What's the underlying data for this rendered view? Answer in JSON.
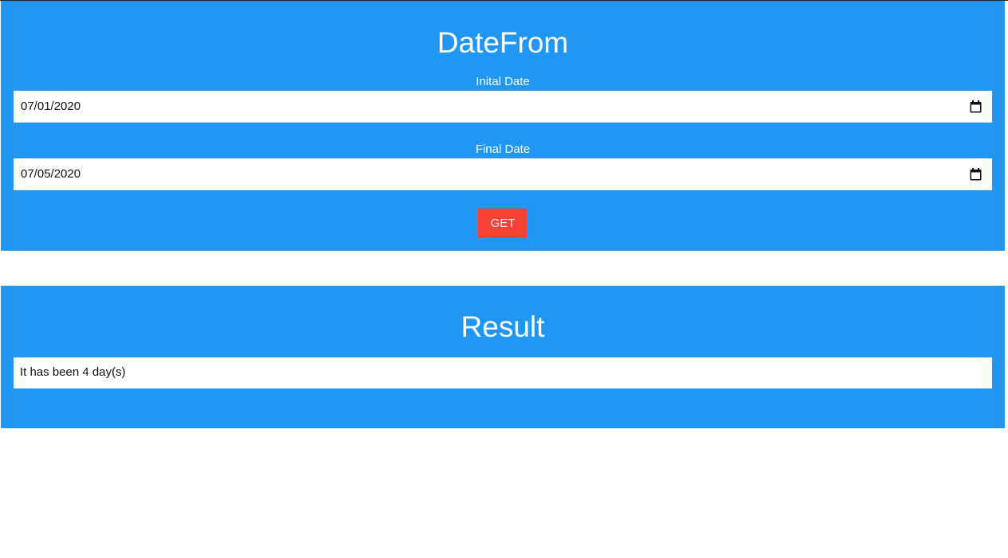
{
  "form": {
    "title": "DateFrom",
    "initial_label": "Inital Date",
    "initial_value": "07/01/2020",
    "final_label": "Final Date",
    "final_value": "07/05/2020",
    "get_label": "GET",
    "icons": {
      "date_picker": "calendar-icon"
    }
  },
  "result": {
    "title": "Result",
    "text": "It has been 4 day(s)"
  },
  "colors": {
    "panel": "#2196f3",
    "button": "#f44336",
    "text_light": "#ffffff"
  }
}
